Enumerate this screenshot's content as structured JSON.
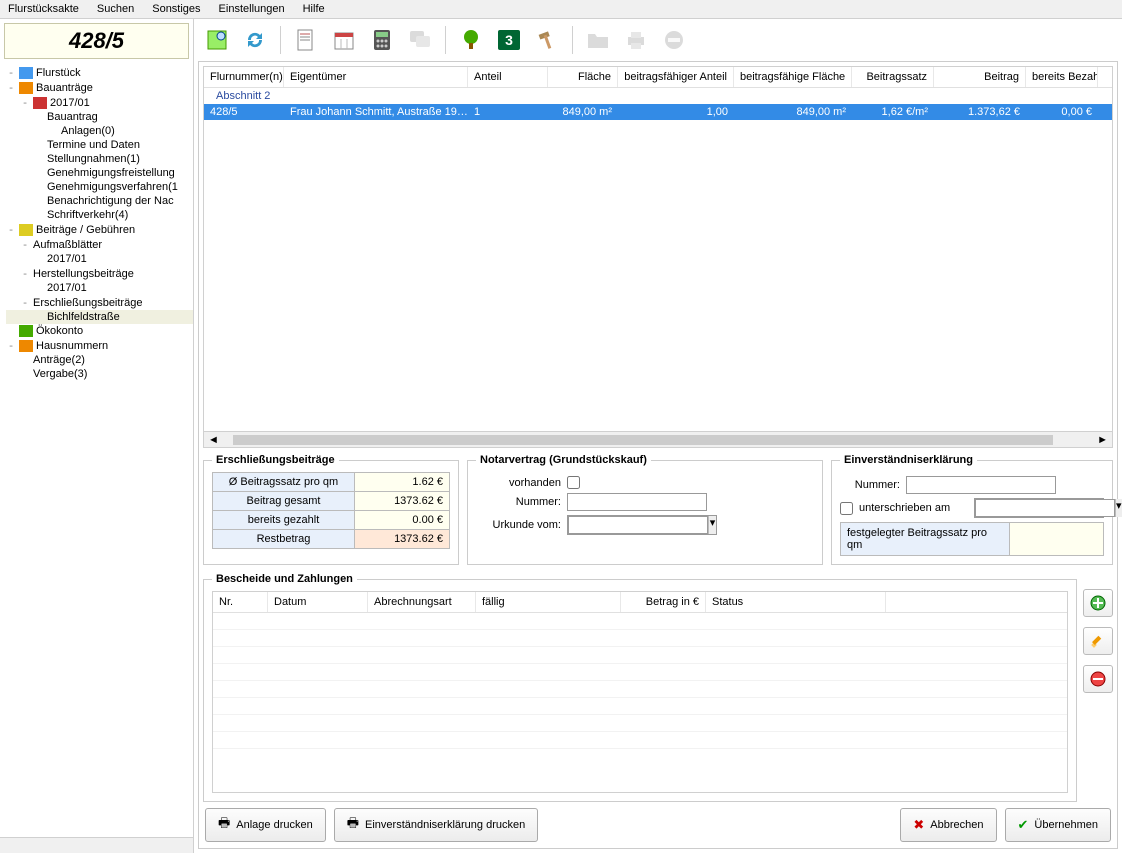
{
  "menu": [
    "Flurstücksakte",
    "Suchen",
    "Sonstiges",
    "Einstellungen",
    "Hilfe"
  ],
  "parcel_title": "428/5",
  "tree": [
    {
      "l": 0,
      "tw": "-",
      "icon": "blue",
      "label": "Flurstück"
    },
    {
      "l": 0,
      "tw": "-",
      "icon": "orange",
      "label": "Bauanträge"
    },
    {
      "l": 1,
      "tw": "-",
      "icon": "red",
      "label": "2017/01"
    },
    {
      "l": 2,
      "tw": "",
      "icon": "",
      "label": "Bauantrag"
    },
    {
      "l": 3,
      "tw": "",
      "icon": "",
      "label": "Anlagen(0)"
    },
    {
      "l": 2,
      "tw": "",
      "icon": "",
      "label": "Termine und Daten"
    },
    {
      "l": 2,
      "tw": "",
      "icon": "",
      "label": "Stellungnahmen(1)"
    },
    {
      "l": 2,
      "tw": "",
      "icon": "",
      "label": "Genehmigungsfreistellung"
    },
    {
      "l": 2,
      "tw": "",
      "icon": "",
      "label": "Genehmigungsverfahren(1"
    },
    {
      "l": 2,
      "tw": "",
      "icon": "",
      "label": "Benachrichtigung der Nac"
    },
    {
      "l": 2,
      "tw": "",
      "icon": "",
      "label": "Schriftverkehr(4)"
    },
    {
      "l": 0,
      "tw": "-",
      "icon": "yellow",
      "label": "Beiträge / Gebühren"
    },
    {
      "l": 1,
      "tw": "-",
      "icon": "",
      "label": "Aufmaßblätter"
    },
    {
      "l": 2,
      "tw": "",
      "icon": "",
      "label": "2017/01"
    },
    {
      "l": 1,
      "tw": "-",
      "icon": "",
      "label": "Herstellungsbeiträge"
    },
    {
      "l": 2,
      "tw": "",
      "icon": "",
      "label": "2017/01"
    },
    {
      "l": 1,
      "tw": "-",
      "icon": "",
      "label": "Erschließungsbeiträge"
    },
    {
      "l": 2,
      "tw": "",
      "icon": "",
      "label": "Bichlfeldstraße",
      "sel": true
    },
    {
      "l": 0,
      "tw": "",
      "icon": "green",
      "label": "Ökokonto"
    },
    {
      "l": 0,
      "tw": "-",
      "icon": "orange",
      "label": "Hausnummern"
    },
    {
      "l": 1,
      "tw": "",
      "icon": "",
      "label": "Anträge(2)"
    },
    {
      "l": 1,
      "tw": "",
      "icon": "",
      "label": "Vergabe(3)"
    }
  ],
  "grid": {
    "headers": [
      "Flurnummer(n)",
      "Eigentümer",
      "Anteil",
      "Fläche",
      "beitragsfähiger Anteil",
      "beitragsfähige Fläche",
      "Beitragssatz",
      "Beitrag",
      "bereits Bezahlt"
    ],
    "group": "Abschnitt 2",
    "row": [
      "428/5",
      "Frau Johann Schmitt, Austraße 19…",
      "1",
      "849,00 m²",
      "1,00",
      "849,00 m²",
      "1,62 €/m²",
      "1.373,62 €",
      "0,00 €"
    ]
  },
  "fs_ersch": {
    "legend": "Erschließungsbeiträge",
    "rows": [
      {
        "label": "Ø Beitragssatz pro qm",
        "value": "1.62 €"
      },
      {
        "label": "Beitrag gesamt",
        "value": "1373.62 €"
      },
      {
        "label": "bereits gezahlt",
        "value": "0.00 €"
      },
      {
        "label": "Restbetrag",
        "value": "1373.62 €",
        "hl": true
      }
    ]
  },
  "fs_notar": {
    "legend": "Notarvertrag (Grundstückskauf)",
    "vorhanden": "vorhanden",
    "nummer": "Nummer:",
    "urkunde": "Urkunde vom:"
  },
  "fs_einv": {
    "legend": "Einverständniserklärung",
    "nummer": "Nummer:",
    "unter": "unterschrieben am",
    "fixed": "festgelegter Beitragssatz pro qm"
  },
  "fs_besch": {
    "legend": "Bescheide und Zahlungen",
    "headers": [
      "Nr.",
      "Datum",
      "Abrechnungsart",
      "fällig",
      "Betrag in €",
      "Status"
    ]
  },
  "buttons": {
    "anlage": "Anlage drucken",
    "einv": "Einverständniserklärung drucken",
    "abbr": "Abbrechen",
    "ueber": "Übernehmen"
  }
}
